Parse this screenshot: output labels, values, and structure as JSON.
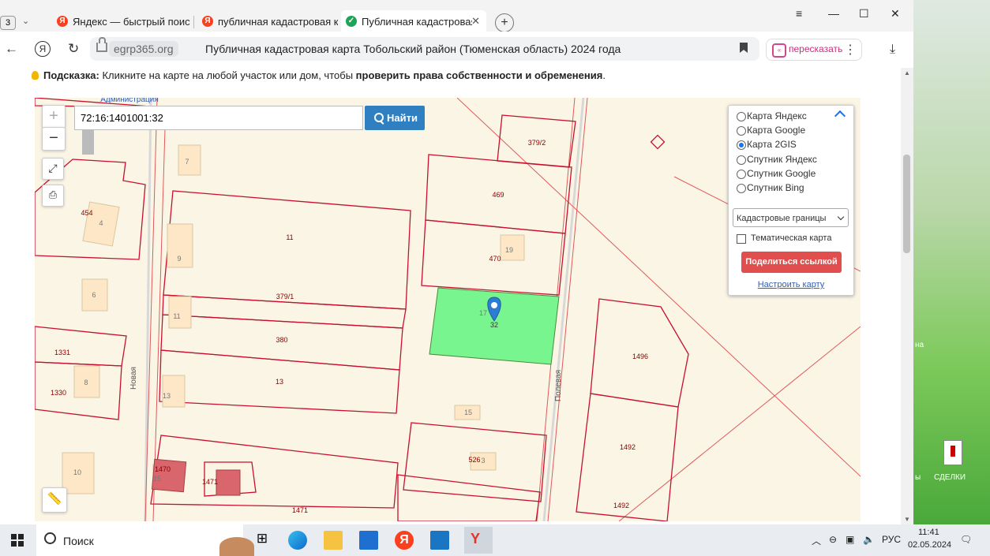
{
  "tabs": {
    "count": "3",
    "items": [
      {
        "label": "Яндекс — быстрый поиск",
        "favicon": "yandex-icon",
        "color": "#fc3f1d"
      },
      {
        "label": "публичная кадастровая к",
        "favicon": "yandex-icon",
        "color": "#fc3f1d"
      },
      {
        "label": "Публичная кадастровая ка",
        "favicon": "check-icon",
        "color": "#1ea456"
      }
    ]
  },
  "address": {
    "domain": "egrp365.org",
    "title": "Публичная кадастровая карта Тобольский район (Тюменская область) 2024 года",
    "retell": "пересказать"
  },
  "hint": {
    "label": "Подсказка:",
    "text": " Кликните на карте на любой участок или дом, чтобы ",
    "bold": "проверить права собственности и обременения",
    "end": "."
  },
  "map": {
    "search_value": "72:16:1401001:32",
    "search_button": "Найти",
    "zoom_in": "+",
    "zoom_out": "−",
    "streets": {
      "left": "Новая",
      "right": "Полевая"
    },
    "parcels": [
      "379/2",
      "469",
      "470",
      "19",
      "454",
      "4",
      "7",
      "11",
      "9",
      "379/1",
      "6",
      "11",
      "380",
      "13",
      "1331",
      "8",
      "1330",
      "13",
      "15",
      "1496",
      "1492",
      "526",
      "3",
      "10",
      "1470",
      "15",
      "1471",
      "1471",
      "1492",
      "32",
      "17"
    ],
    "highlight_parcel": "32",
    "top_label": "Администрация",
    "highlight_color": "#79f58f",
    "boundary_color": "#c8102e"
  },
  "panel": {
    "options": [
      {
        "label": "Карта Яндекс",
        "selected": false
      },
      {
        "label": "Карта Google",
        "selected": false
      },
      {
        "label": "Карта 2GIS",
        "selected": true
      },
      {
        "label": "Спутник Яндекс",
        "selected": false
      },
      {
        "label": "Спутник Google",
        "selected": false
      },
      {
        "label": "Спутник Bing",
        "selected": false
      }
    ],
    "layer": "Кадастровые границы",
    "thematic": "Тематическая карта",
    "share": "Поделиться ссылкой",
    "configure": "Настроить карту"
  },
  "desktop": {
    "label_a": "на",
    "label_b": "ы",
    "folder": "СДЕЛКИ"
  },
  "taskbar": {
    "search": "Поиск",
    "lang": "РУС",
    "time": "11:41",
    "date": "02.05.2024"
  }
}
